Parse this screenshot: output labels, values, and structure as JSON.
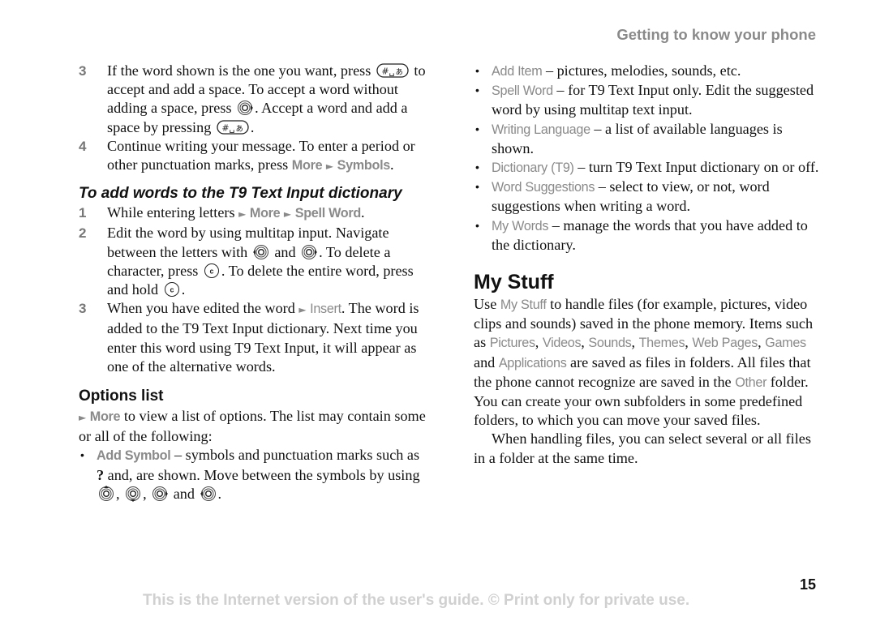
{
  "header": {
    "section_title": "Getting to know your phone"
  },
  "left": {
    "steps_a": [
      {
        "num": "3",
        "t1": "If the word shown is the one you want, press",
        "t2": " to accept and add a space. To accept a word without adding a space, press ",
        "t3": ". Accept a word and add a space by pressing ",
        "t4": "."
      },
      {
        "num": "4",
        "t1": "Continue writing your message. To enter a period or other punctuation marks, press ",
        "menu1": "More",
        "menu2": "Symbols",
        "t2": "."
      }
    ],
    "sub_heading": "To add words to the T9 Text Input dictionary",
    "steps_b": [
      {
        "num": "1",
        "t1": "While entering letters ",
        "menu1": "More",
        "menu2": "Spell Word",
        "t2": "."
      },
      {
        "num": "2",
        "t1": "Edit the word by using multitap input. Navigate between the letters with ",
        "t2": " and ",
        "t3": ". To delete a character, press ",
        "t4": ". To delete the entire word, press and hold ",
        "t5": "."
      },
      {
        "num": "3",
        "t1": "When you have edited the word ",
        "menu1": "Insert",
        "t2": ". The word is added to the T9 Text Input dictionary. Next time you enter this word using T9 Text Input, it will appear as one of the alternative words."
      }
    ],
    "options_heading": "Options list",
    "options_intro": {
      "menu": "More",
      "text": " to view a list of options. The list may contain some or all of the following:"
    },
    "add_symbol": {
      "label": "Add Symbol",
      "t1": " – symbols and punctuation marks such as ",
      "q": "?",
      "t2": " and, are shown. Move between the symbols by using ",
      "sep1": ", ",
      "sep2": ", ",
      "t3": " and ",
      "t4": "."
    }
  },
  "right": {
    "options": [
      {
        "label": "Add Item",
        "text": " – pictures, melodies, sounds, etc."
      },
      {
        "label": "Spell Word",
        "text": " – for T9 Text Input only. Edit the suggested word by using multitap text input."
      },
      {
        "label": "Writing Language",
        "text": " – a list of available languages is shown."
      },
      {
        "label": "Dictionary (T9)",
        "text": " – turn T9 Text Input dictionary on or off."
      },
      {
        "label": "Word Suggestions",
        "text": " – select to view, or not, word suggestions when writing a word."
      },
      {
        "label": "My Words",
        "text": " – manage the words that you have added to the dictionary."
      }
    ],
    "my_stuff": {
      "heading": "My Stuff",
      "p1": {
        "a": "Use ",
        "my_stuff": "My Stuff",
        "b": " to handle files (for example, pictures, video clips and sounds) saved in the phone memory. Items such as ",
        "pictures": "Pictures",
        "c1": ", ",
        "videos": "Videos",
        "c2": ", ",
        "sounds": "Sounds",
        "c3": ", ",
        "themes": "Themes",
        "c4": ", ",
        "web_pages": "Web Pages",
        "c5": ", ",
        "games": "Games",
        "c6": " and ",
        "applications": "Applications",
        "d": " are saved as files in folders. All files that the phone cannot recognize are saved in the ",
        "other": "Other",
        "e": " folder. You can create your own subfolders in some predefined folders, to which you can move your saved files."
      },
      "p2": "When handling files, you can select several or all files in a folder at the same time."
    }
  },
  "icons": {
    "hash_space_key": "#␣",
    "clear_key": "c",
    "menu_arrow": "►"
  },
  "page_number": "15",
  "footer": "This is the Internet version of the user's guide. © Print only for private use.",
  "colors": {
    "highlight": "#8a8a8a",
    "footer": "#d0d0d0",
    "text": "#111111"
  }
}
